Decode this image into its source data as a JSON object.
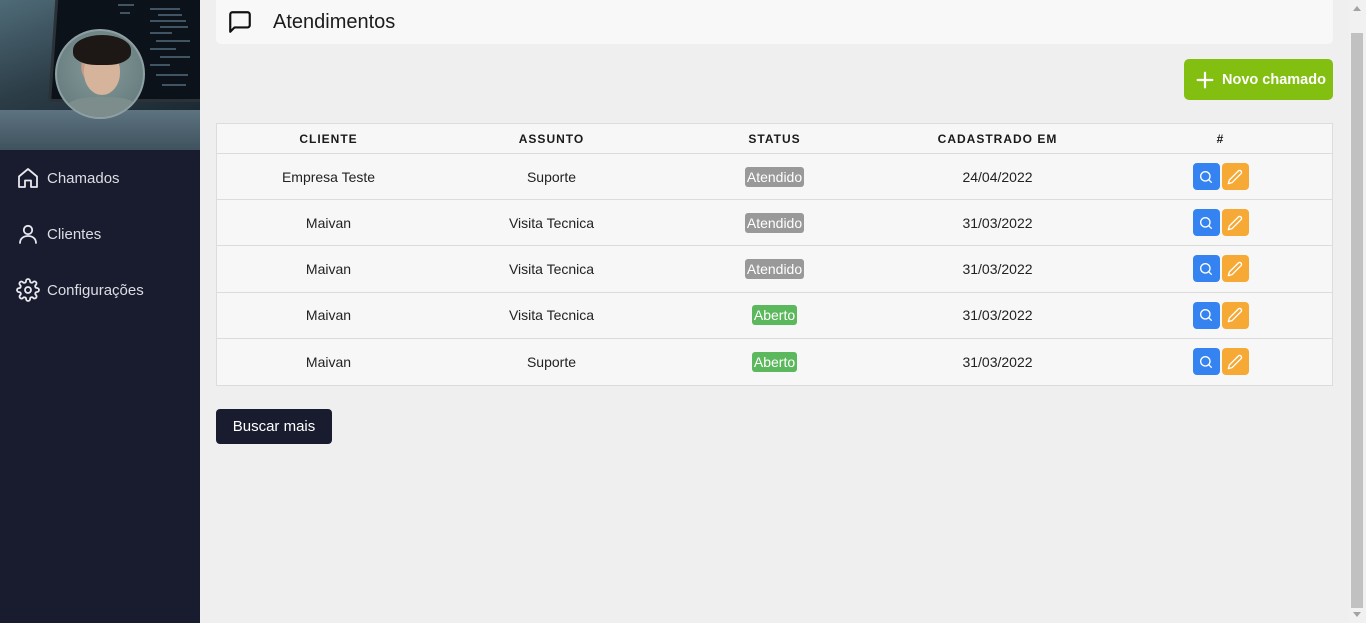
{
  "sidebar": {
    "items": [
      {
        "label": "Chamados",
        "icon": "home-icon"
      },
      {
        "label": "Clientes",
        "icon": "user-icon"
      },
      {
        "label": "Configurações",
        "icon": "gear-icon"
      }
    ]
  },
  "header": {
    "title": "Atendimentos",
    "icon": "message-square-icon"
  },
  "actions": {
    "new_label": "Novo chamado",
    "more_label": "Buscar mais"
  },
  "table": {
    "columns": [
      "CLIENTE",
      "ASSUNTO",
      "STATUS",
      "CADASTRADO EM",
      "#"
    ],
    "rows": [
      {
        "cliente": "Empresa Teste",
        "assunto": "Suporte",
        "status": "Atendido",
        "data": "24/04/2022"
      },
      {
        "cliente": "Maivan",
        "assunto": "Visita Tecnica",
        "status": "Atendido",
        "data": "31/03/2022"
      },
      {
        "cliente": "Maivan",
        "assunto": "Visita Tecnica",
        "status": "Atendido",
        "data": "31/03/2022"
      },
      {
        "cliente": "Maivan",
        "assunto": "Visita Tecnica",
        "status": "Aberto",
        "data": "31/03/2022"
      },
      {
        "cliente": "Maivan",
        "assunto": "Suporte",
        "status": "Aberto",
        "data": "31/03/2022"
      }
    ]
  },
  "colors": {
    "sidebar": "#181c2e",
    "new_button": "#83bf10",
    "status_atendido": "#999999",
    "status_aberto": "#5cb85c",
    "view_button": "#3583f0",
    "edit_button": "#f6a935"
  }
}
